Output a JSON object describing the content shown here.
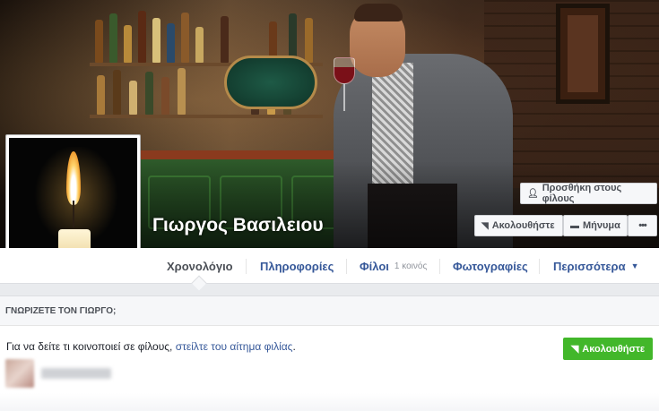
{
  "profile": {
    "name": "Γιωργος Βασιλειου"
  },
  "cover_actions": {
    "add_friend": "Προσθήκη στους φίλους",
    "follow": "Ακολουθήστε",
    "message": "Μήνυμα",
    "more": "•••"
  },
  "nav": {
    "tabs": [
      {
        "label": "Χρονολόγιο"
      },
      {
        "label": "Πληροφορίες"
      },
      {
        "label": "Φίλοι",
        "sub": "1 κοινός"
      },
      {
        "label": "Φωτογραφίες"
      },
      {
        "label": "Περισσότερα",
        "caret": "▼"
      }
    ]
  },
  "know_section": {
    "heading": "ΓΝΩΡΙΖΕΤΕ ΤΟΝ ΓΙΩΡΓΟ;",
    "text_before": "Για να δείτε τι κοινοποιεί σε φίλους, ",
    "link": "στείλτε του αίτημα φιλίας",
    "text_after": ".",
    "follow_button": "Ακολουθήστε"
  },
  "icons": {
    "add_friend": "add-friend-icon",
    "follow": "rss-icon",
    "message": "message-icon"
  },
  "colors": {
    "link": "#365899",
    "follow_green": "#42b72a",
    "header_bg": "#f6f7f9"
  }
}
